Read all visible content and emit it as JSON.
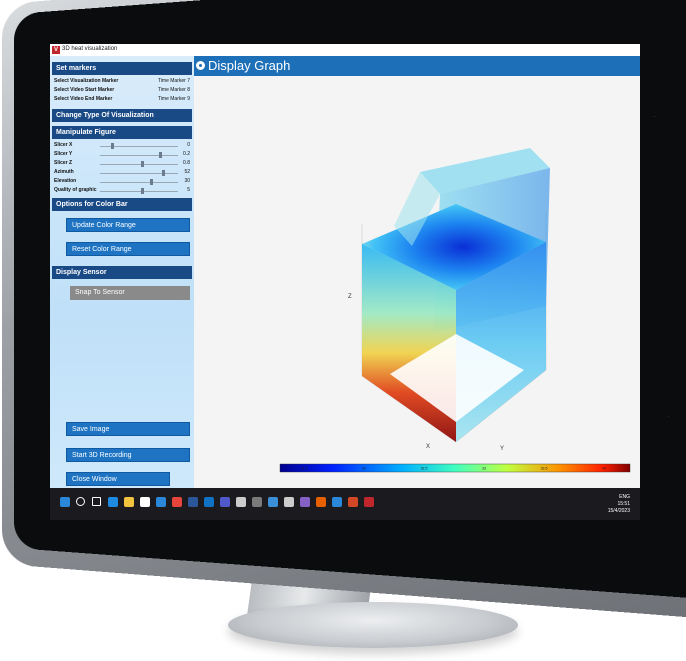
{
  "window": {
    "title": "3D heat visualization",
    "app_icon": "V",
    "controls": "–  ▢  ✕"
  },
  "sidebar": {
    "set_markers_header": "Set markers",
    "markers": [
      {
        "label": "Select Visualization Marker",
        "value": "Time Marker 7"
      },
      {
        "label": "Select Video Start Marker",
        "value": "Time Marker 8"
      },
      {
        "label": "Select Video End Marker",
        "value": "Time Marker 9"
      }
    ],
    "change_type_header": "Change Type Of Visualization",
    "manipulate_header": "Manipulate Figure",
    "sliders": [
      {
        "label": "Slicer X",
        "value": "0",
        "fraction": 0.15
      },
      {
        "label": "Slicer Y",
        "value": "0.2",
        "fraction": 0.78
      },
      {
        "label": "Slicer Z",
        "value": "0.8",
        "fraction": 0.55
      },
      {
        "label": "Azimuth",
        "value": "52",
        "fraction": 0.82
      },
      {
        "label": "Elevation",
        "value": "30",
        "fraction": 0.66
      },
      {
        "label": "Quality of graphic",
        "value": "5",
        "fraction": 0.55
      }
    ],
    "color_bar_header": "Options for Color Bar",
    "update_color_range": "Update Color Range",
    "reset_color_range": "Reset Color Range",
    "display_sensor_header": "Display Sensor",
    "snap_to_sensor": "Snap To Sensor",
    "save_image": "Save Image",
    "start_3d_recording": "Start 3D Recording",
    "close_window": "Close Window",
    "help": "?"
  },
  "main": {
    "title": "Display Graph",
    "axes": {
      "x": "X",
      "y": "Y",
      "z": "Z"
    },
    "colorbar_ticks": [
      "31.5",
      "32",
      "32.5",
      "33",
      "33.5",
      "34"
    ]
  },
  "taskbar": {
    "time": "15:51",
    "lang": "ENG",
    "date": "15/4/2023",
    "icons": [
      "windows-start-icon",
      "search-icon",
      "task-view-icon",
      "edge-icon",
      "file-explorer-icon",
      "store-icon",
      "mail-icon",
      "chrome-icon",
      "word-icon",
      "outlook-icon",
      "teams-icon",
      "terminal-icon",
      "app-icon-1",
      "app-icon-2",
      "settings-icon",
      "visual-studio-icon",
      "firefox-icon",
      "app-icon-3",
      "powerpoint-icon",
      "matlab-icon"
    ],
    "icon_colors": [
      "#2b88d8",
      "#ffffff",
      "#ffffff",
      "#1f8be0",
      "#f2c33c",
      "#ffffff",
      "#2b88d8",
      "#e7453c",
      "#2b579a",
      "#1171c2",
      "#5059c9",
      "#cccccc",
      "#7a7a7a",
      "#3a8fd6",
      "#cccccc",
      "#8661c5",
      "#e66000",
      "#2b88d8",
      "#d24726",
      "#c0272d"
    ]
  }
}
